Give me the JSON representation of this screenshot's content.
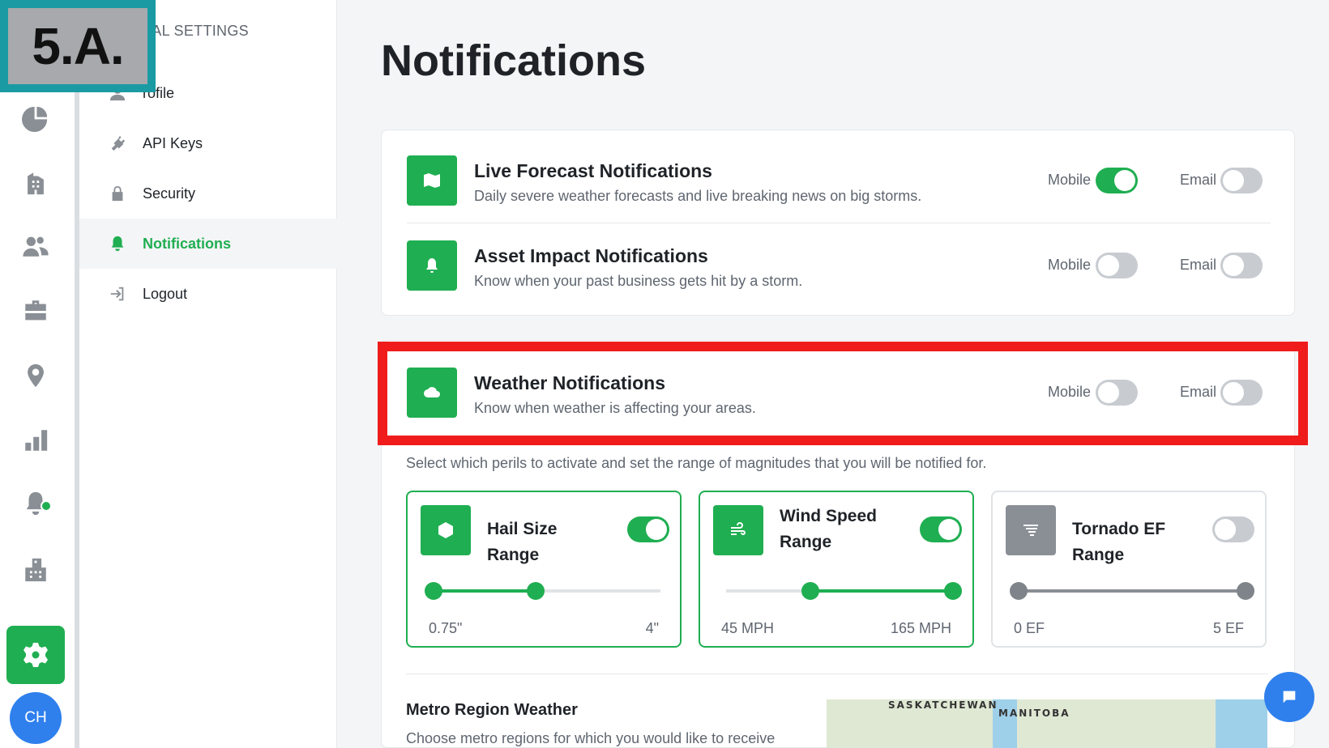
{
  "step_label": "5.A.",
  "rail": {
    "avatar_initials": "CH",
    "icons": [
      "pie-chart-icon",
      "building-icon",
      "users-icon",
      "briefcase-icon",
      "map-pin-icon",
      "bar-chart-icon",
      "bell-icon",
      "office-icon",
      "gear-icon"
    ]
  },
  "sidebar": {
    "section_title": "PERSONAL SETTINGS",
    "section_title_visible": "NAL SETTINGS",
    "items": [
      {
        "label": "Profile",
        "visible": "rofile",
        "icon": "user-icon"
      },
      {
        "label": "API Keys",
        "icon": "plug-icon"
      },
      {
        "label": "Security",
        "icon": "lock-icon"
      },
      {
        "label": "Notifications",
        "icon": "bell-icon",
        "active": true
      },
      {
        "label": "Logout",
        "icon": "logout-icon"
      }
    ]
  },
  "page": {
    "title": "Notifications"
  },
  "notifications": [
    {
      "title": "Live Forecast Notifications",
      "subtitle": "Daily severe weather forecasts and live breaking news on big storms.",
      "icon": "map-icon",
      "mobile": true,
      "email": false
    },
    {
      "title": "Asset Impact Notifications",
      "subtitle": "Know when your past business gets hit by a storm.",
      "icon": "bell-icon",
      "mobile": false,
      "email": false
    },
    {
      "title": "Weather Notifications",
      "subtitle": "Know when weather is affecting your areas.",
      "icon": "cloud-icon",
      "mobile": false,
      "email": false
    }
  ],
  "toggle_labels": {
    "mobile": "Mobile",
    "email": "Email"
  },
  "perils": {
    "help_text": "Select which perils to activate and set the range of magnitudes that you will be notified for.",
    "items": [
      {
        "title": "Hail Size Range",
        "icon": "hexagon-icon",
        "enabled": true,
        "min_label": "0.75\"",
        "max_label": "4\"",
        "range": [
          0,
          0.45
        ]
      },
      {
        "title": "Wind Speed Range",
        "icon": "wind-icon",
        "enabled": true,
        "min_label": "45 MPH",
        "max_label": "165 MPH",
        "range": [
          0.37,
          1.0
        ]
      },
      {
        "title": "Tornado EF Range",
        "icon": "tornado-icon",
        "enabled": false,
        "min_label": "0 EF",
        "max_label": "5 EF",
        "range": [
          0,
          1.0
        ]
      }
    ]
  },
  "metro": {
    "title": "Metro Region Weather",
    "subtitle": "Choose metro regions for which you would like to receive",
    "map_labels": [
      "SASKATCHEWAN",
      "MANITOBA"
    ]
  },
  "colors": {
    "accent": "#1fae51",
    "highlight": "#f01c1c",
    "stamp": "#1a9aa3",
    "chat": "#2f80ed"
  }
}
